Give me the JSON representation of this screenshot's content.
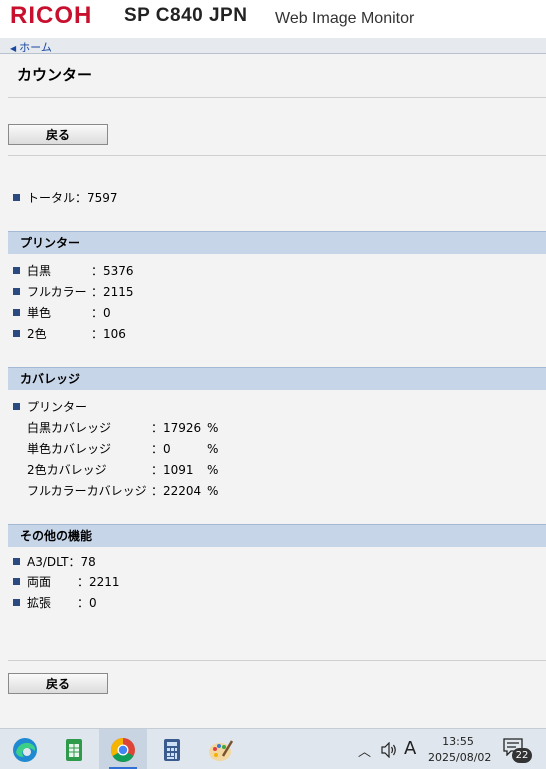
{
  "header": {
    "brand": "RICOH",
    "model": "SP C840 JPN",
    "app_name": "Web Image Monitor"
  },
  "nav": {
    "home": "ホーム"
  },
  "page": {
    "title": "カウンター",
    "back_label": "戻る"
  },
  "total": {
    "label": "トータル",
    "sep": "：",
    "value": "7597"
  },
  "printer": {
    "heading": "プリンター",
    "items": [
      {
        "label": "白黒",
        "value": "5376"
      },
      {
        "label": "フルカラー",
        "value": "2115"
      },
      {
        "label": "単色",
        "value": "0"
      },
      {
        "label": "2色",
        "value": "106"
      }
    ]
  },
  "coverage": {
    "heading": "カバレッジ",
    "sub_heading": "プリンター",
    "items": [
      {
        "label": "白黒カバレッジ",
        "value": "17926",
        "unit": "%"
      },
      {
        "label": "単色カバレッジ",
        "value": "0",
        "unit": "%"
      },
      {
        "label": "2色カバレッジ",
        "value": "1091",
        "unit": "%"
      },
      {
        "label": "フルカラーカバレッジ",
        "value": "22204",
        "unit": "%"
      }
    ]
  },
  "other": {
    "heading": "その他の機能",
    "items": [
      {
        "label": "A3/DLT",
        "value": "78"
      },
      {
        "label": "両面",
        "value": "2211"
      },
      {
        "label": "拡張",
        "value": "0"
      }
    ]
  },
  "taskbar": {
    "time": "13:55",
    "date": "2025/08/02",
    "notifications": "22",
    "ime": "A"
  },
  "colors": {
    "brand": "#c8102e",
    "section_bg": "#c7d5e8",
    "bullet": "#2b4a80",
    "link": "#1a48a0"
  }
}
